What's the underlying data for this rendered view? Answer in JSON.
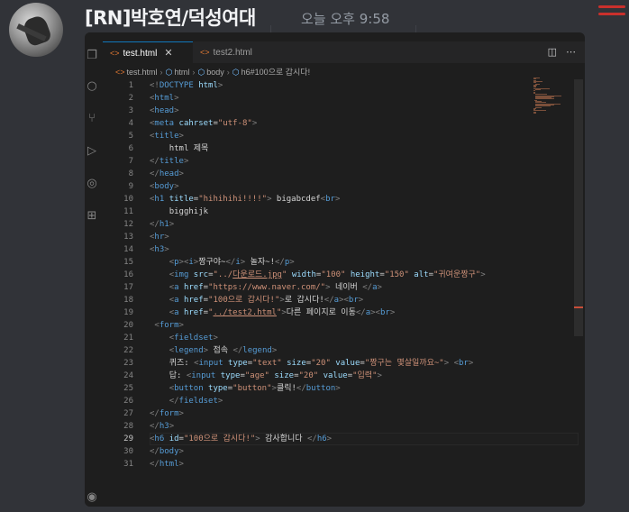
{
  "message": {
    "username": "[RN]박호연/덕성여대",
    "timestamp": "오늘 오후 9:58"
  },
  "colors": {
    "tag": "#569cd6",
    "attribute": "#9cdcfe",
    "string": "#ce9178",
    "text": "#d4d4d4",
    "html_file_icon": "#e37933"
  },
  "editor": {
    "tabs": [
      {
        "label": "test.html",
        "active": true,
        "icon": "html-file-icon"
      },
      {
        "label": "test2.html",
        "active": false,
        "icon": "html-file-icon"
      }
    ],
    "breadcrumb": [
      "test.html",
      "html",
      "body",
      "h6#100으로 갑시다!"
    ],
    "current_line": 29,
    "lines": [
      {
        "n": "1",
        "indent": "",
        "segs": [
          [
            "p",
            "<!"
          ],
          [
            "t",
            "DOCTYPE"
          ],
          [
            "x",
            " "
          ],
          [
            "a",
            "html"
          ],
          [
            "p",
            ">"
          ]
        ]
      },
      {
        "n": "2",
        "indent": "",
        "segs": [
          [
            "p",
            "<"
          ],
          [
            "t",
            "html"
          ],
          [
            "p",
            ">"
          ]
        ]
      },
      {
        "n": "3",
        "indent": "",
        "segs": [
          [
            "p",
            "<"
          ],
          [
            "t",
            "head"
          ],
          [
            "p",
            ">"
          ]
        ]
      },
      {
        "n": "4",
        "indent": "",
        "segs": [
          [
            "p",
            "<"
          ],
          [
            "t",
            "meta"
          ],
          [
            "x",
            " "
          ],
          [
            "a",
            "cahrset"
          ],
          [
            "x",
            "="
          ],
          [
            "s",
            "\"utf-8\""
          ],
          [
            "p",
            ">"
          ]
        ]
      },
      {
        "n": "5",
        "indent": "",
        "segs": [
          [
            "p",
            "<"
          ],
          [
            "t",
            "title"
          ],
          [
            "p",
            ">"
          ]
        ]
      },
      {
        "n": "6",
        "indent": "    ",
        "segs": [
          [
            "x",
            "html 제목"
          ]
        ]
      },
      {
        "n": "7",
        "indent": "",
        "segs": [
          [
            "p",
            "</"
          ],
          [
            "t",
            "title"
          ],
          [
            "p",
            ">"
          ]
        ]
      },
      {
        "n": "8",
        "indent": "",
        "segs": [
          [
            "p",
            "</"
          ],
          [
            "t",
            "head"
          ],
          [
            "p",
            ">"
          ]
        ]
      },
      {
        "n": "9",
        "indent": "",
        "segs": [
          [
            "p",
            "<"
          ],
          [
            "t",
            "body"
          ],
          [
            "p",
            ">"
          ]
        ]
      },
      {
        "n": "10",
        "indent": "",
        "segs": [
          [
            "p",
            "<"
          ],
          [
            "t",
            "h1"
          ],
          [
            "x",
            " "
          ],
          [
            "a",
            "title"
          ],
          [
            "x",
            "="
          ],
          [
            "s",
            "\"hihihihi!!!!\""
          ],
          [
            "p",
            ">"
          ],
          [
            "x",
            " bigabcdef"
          ],
          [
            "p",
            "<"
          ],
          [
            "t",
            "br"
          ],
          [
            "p",
            ">"
          ]
        ]
      },
      {
        "n": "11",
        "indent": "    ",
        "segs": [
          [
            "x",
            "bigghijk"
          ]
        ]
      },
      {
        "n": "12",
        "indent": "",
        "segs": [
          [
            "p",
            "</"
          ],
          [
            "t",
            "h1"
          ],
          [
            "p",
            ">"
          ]
        ]
      },
      {
        "n": "13",
        "indent": "",
        "segs": [
          [
            "p",
            "<"
          ],
          [
            "t",
            "hr"
          ],
          [
            "p",
            ">"
          ]
        ]
      },
      {
        "n": "14",
        "indent": "",
        "segs": [
          [
            "p",
            "<"
          ],
          [
            "t",
            "h3"
          ],
          [
            "p",
            ">"
          ]
        ]
      },
      {
        "n": "15",
        "indent": "    ",
        "segs": [
          [
            "p",
            "<"
          ],
          [
            "t",
            "p"
          ],
          [
            "p",
            "><"
          ],
          [
            "t",
            "i"
          ],
          [
            "p",
            ">"
          ],
          [
            "x",
            "짱구야~"
          ],
          [
            "p",
            "</"
          ],
          [
            "t",
            "i"
          ],
          [
            "p",
            ">"
          ],
          [
            "x",
            " 놀자~!"
          ],
          [
            "p",
            "</"
          ],
          [
            "t",
            "p"
          ],
          [
            "p",
            ">"
          ]
        ]
      },
      {
        "n": "16",
        "indent": "    ",
        "segs": [
          [
            "p",
            "<"
          ],
          [
            "t",
            "img"
          ],
          [
            "x",
            " "
          ],
          [
            "a",
            "src"
          ],
          [
            "x",
            "="
          ],
          [
            "s",
            "\"../"
          ],
          [
            "u",
            "다운로드.jpg"
          ],
          [
            "s",
            "\""
          ],
          [
            "x",
            " "
          ],
          [
            "a",
            "width"
          ],
          [
            "x",
            "="
          ],
          [
            "s",
            "\"100\""
          ],
          [
            "x",
            " "
          ],
          [
            "a",
            "height"
          ],
          [
            "x",
            "="
          ],
          [
            "s",
            "\"150\""
          ],
          [
            "x",
            " "
          ],
          [
            "a",
            "alt"
          ],
          [
            "x",
            "="
          ],
          [
            "s",
            "\"귀여운짱구\""
          ],
          [
            "p",
            ">"
          ]
        ]
      },
      {
        "n": "17",
        "indent": "    ",
        "segs": [
          [
            "p",
            "<"
          ],
          [
            "t",
            "a"
          ],
          [
            "x",
            " "
          ],
          [
            "a",
            "href"
          ],
          [
            "x",
            "="
          ],
          [
            "s",
            "\"https://www.naver.com/\""
          ],
          [
            "p",
            ">"
          ],
          [
            "x",
            " 네이버 "
          ],
          [
            "p",
            "</"
          ],
          [
            "t",
            "a"
          ],
          [
            "p",
            ">"
          ]
        ]
      },
      {
        "n": "18",
        "indent": "    ",
        "segs": [
          [
            "p",
            "<"
          ],
          [
            "t",
            "a"
          ],
          [
            "x",
            " "
          ],
          [
            "a",
            "href"
          ],
          [
            "x",
            "="
          ],
          [
            "s",
            "\"100으로 갑시다!\""
          ],
          [
            "p",
            ">"
          ],
          [
            "x",
            "로 갑시다!"
          ],
          [
            "p",
            "</"
          ],
          [
            "t",
            "a"
          ],
          [
            "p",
            "><"
          ],
          [
            "t",
            "br"
          ],
          [
            "p",
            ">"
          ]
        ]
      },
      {
        "n": "19",
        "indent": "    ",
        "segs": [
          [
            "p",
            "<"
          ],
          [
            "t",
            "a"
          ],
          [
            "x",
            " "
          ],
          [
            "a",
            "href"
          ],
          [
            "x",
            "="
          ],
          [
            "s",
            "\""
          ],
          [
            "u",
            "../test2.html"
          ],
          [
            "s",
            "\""
          ],
          [
            "p",
            ">"
          ],
          [
            "x",
            "다른 페이지로 이동"
          ],
          [
            "p",
            "</"
          ],
          [
            "t",
            "a"
          ],
          [
            "p",
            "><"
          ],
          [
            "t",
            "br"
          ],
          [
            "p",
            ">"
          ]
        ]
      },
      {
        "n": "20",
        "indent": " ",
        "segs": [
          [
            "p",
            "<"
          ],
          [
            "t",
            "form"
          ],
          [
            "p",
            ">"
          ]
        ]
      },
      {
        "n": "21",
        "indent": "    ",
        "segs": [
          [
            "p",
            "<"
          ],
          [
            "t",
            "fieldset"
          ],
          [
            "p",
            ">"
          ]
        ]
      },
      {
        "n": "22",
        "indent": "    ",
        "segs": [
          [
            "p",
            "<"
          ],
          [
            "t",
            "legend"
          ],
          [
            "p",
            ">"
          ],
          [
            "x",
            " 접속 "
          ],
          [
            "p",
            "</"
          ],
          [
            "t",
            "legend"
          ],
          [
            "p",
            ">"
          ]
        ]
      },
      {
        "n": "23",
        "indent": "    ",
        "segs": [
          [
            "x",
            "퀴즈: "
          ],
          [
            "p",
            "<"
          ],
          [
            "t",
            "input"
          ],
          [
            "x",
            " "
          ],
          [
            "a",
            "type"
          ],
          [
            "x",
            "="
          ],
          [
            "s",
            "\"text\""
          ],
          [
            "x",
            " "
          ],
          [
            "a",
            "size"
          ],
          [
            "x",
            "="
          ],
          [
            "s",
            "\"20\""
          ],
          [
            "x",
            " "
          ],
          [
            "a",
            "value"
          ],
          [
            "x",
            "="
          ],
          [
            "s",
            "\"짱구는 몇살일까요~\""
          ],
          [
            "p",
            ">"
          ],
          [
            "x",
            " "
          ],
          [
            "p",
            "<"
          ],
          [
            "t",
            "br"
          ],
          [
            "p",
            ">"
          ]
        ]
      },
      {
        "n": "24",
        "indent": "    ",
        "segs": [
          [
            "x",
            "답: "
          ],
          [
            "p",
            "<"
          ],
          [
            "t",
            "input"
          ],
          [
            "x",
            " "
          ],
          [
            "a",
            "type"
          ],
          [
            "x",
            "="
          ],
          [
            "s",
            "\"age\""
          ],
          [
            "x",
            " "
          ],
          [
            "a",
            "size"
          ],
          [
            "x",
            "="
          ],
          [
            "s",
            "\"20\""
          ],
          [
            "x",
            " "
          ],
          [
            "a",
            "value"
          ],
          [
            "x",
            "="
          ],
          [
            "s",
            "\"입력\""
          ],
          [
            "p",
            ">"
          ]
        ]
      },
      {
        "n": "25",
        "indent": "    ",
        "segs": [
          [
            "p",
            "<"
          ],
          [
            "t",
            "button"
          ],
          [
            "x",
            " "
          ],
          [
            "a",
            "type"
          ],
          [
            "x",
            "="
          ],
          [
            "s",
            "\"button\""
          ],
          [
            "p",
            ">"
          ],
          [
            "x",
            "클릭!"
          ],
          [
            "p",
            "</"
          ],
          [
            "t",
            "button"
          ],
          [
            "p",
            ">"
          ]
        ]
      },
      {
        "n": "26",
        "indent": "    ",
        "segs": [
          [
            "p",
            "</"
          ],
          [
            "t",
            "fieldset"
          ],
          [
            "p",
            ">"
          ]
        ]
      },
      {
        "n": "27",
        "indent": "",
        "segs": [
          [
            "p",
            "</"
          ],
          [
            "t",
            "form"
          ],
          [
            "p",
            ">"
          ]
        ]
      },
      {
        "n": "28",
        "indent": "",
        "segs": [
          [
            "p",
            "</"
          ],
          [
            "t",
            "h3"
          ],
          [
            "p",
            ">"
          ]
        ]
      },
      {
        "n": "29",
        "indent": "",
        "segs": [
          [
            "p",
            "<"
          ],
          [
            "t",
            "h6"
          ],
          [
            "x",
            " "
          ],
          [
            "a",
            "id"
          ],
          [
            "x",
            "="
          ],
          [
            "s",
            "\"100으로 갑시다!\""
          ],
          [
            "p",
            ">"
          ],
          [
            "x",
            " 감사합니다 "
          ],
          [
            "p",
            "</"
          ],
          [
            "t",
            "h6"
          ],
          [
            "p",
            ">"
          ]
        ]
      },
      {
        "n": "30",
        "indent": "",
        "segs": [
          [
            "p",
            "</"
          ],
          [
            "t",
            "body"
          ],
          [
            "p",
            ">"
          ]
        ]
      },
      {
        "n": "31",
        "indent": "",
        "segs": [
          [
            "p",
            "</"
          ],
          [
            "t",
            "html"
          ],
          [
            "p",
            ">"
          ]
        ]
      }
    ]
  }
}
